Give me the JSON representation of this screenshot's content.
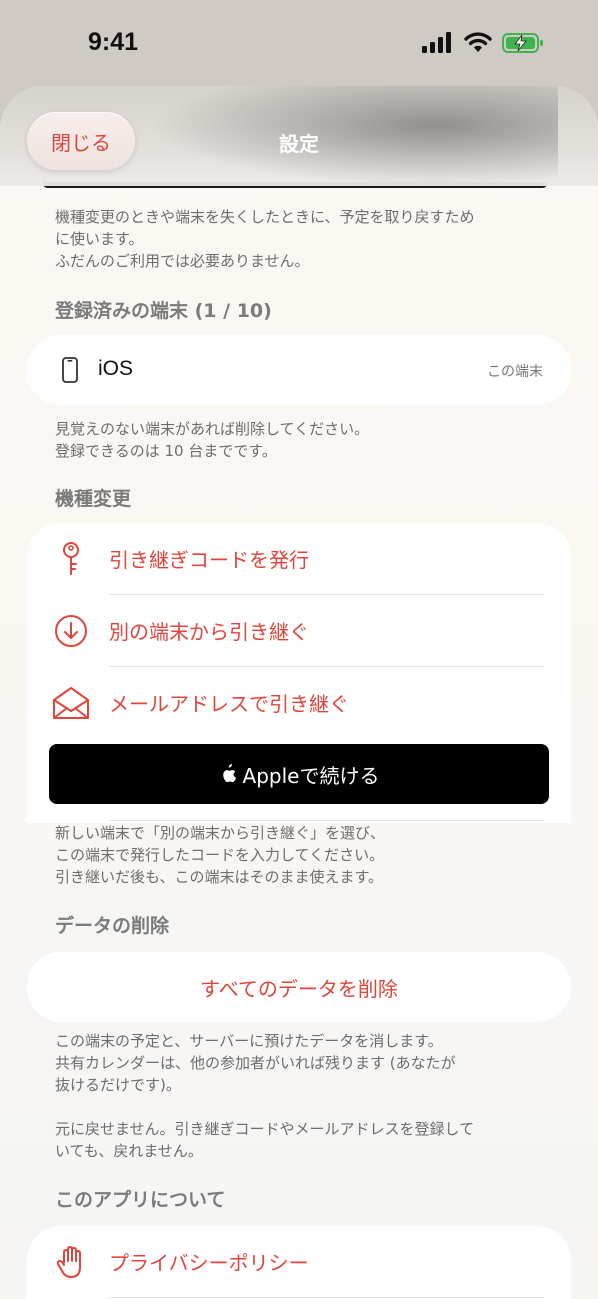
{
  "status_bar": {
    "time": "9:41"
  },
  "sheet": {
    "close_label": "閉じる",
    "title": "設定"
  },
  "sections": {
    "recovery_note": [
      "機種変更のときや端末を失くしたときに、予定を取り戻すため",
      "に使います。",
      "ふだんのご利用では必要ありません。"
    ],
    "devices": {
      "header": "登録済みの端末 (1 / 10)",
      "device_name": "iOS",
      "device_badge": "この端末",
      "note": [
        "見覚えのない端末があれば削除してください。",
        "登録できるのは 10 台までです。"
      ]
    },
    "transfer": {
      "header": "機種変更",
      "items": [
        {
          "label": "引き継ぎコードを発行",
          "icon": "key-icon"
        },
        {
          "label": "別の端末から引き継ぐ",
          "icon": "download-circle-icon"
        },
        {
          "label": "メールアドレスで引き継ぐ",
          "icon": "envelope-icon"
        }
      ],
      "apple_button": "Appleで続ける",
      "note": [
        "新しい端末で「別の端末から引き継ぐ」を選び、",
        "この端末で発行したコードを入力してください。",
        "引き継いだ後も、この端末はそのまま使えます。"
      ]
    },
    "delete": {
      "header": "データの削除",
      "button": "すべてのデータを削除",
      "note": [
        "この端末の予定と、サーバーに預けたデータを消します。",
        "共有カレンダーは、他の参加者がいれば残ります (あなたが",
        "抜けるだけです)。",
        "",
        "元に戻せません。引き継ぎコードやメールアドレスを登録して",
        "いても、戻れません。"
      ]
    },
    "about": {
      "header": "このアプリについて",
      "privacy_label": "プライバシーポリシー"
    }
  },
  "colors": {
    "accent": "#e0453b",
    "footnote": "#6d6d6d"
  }
}
